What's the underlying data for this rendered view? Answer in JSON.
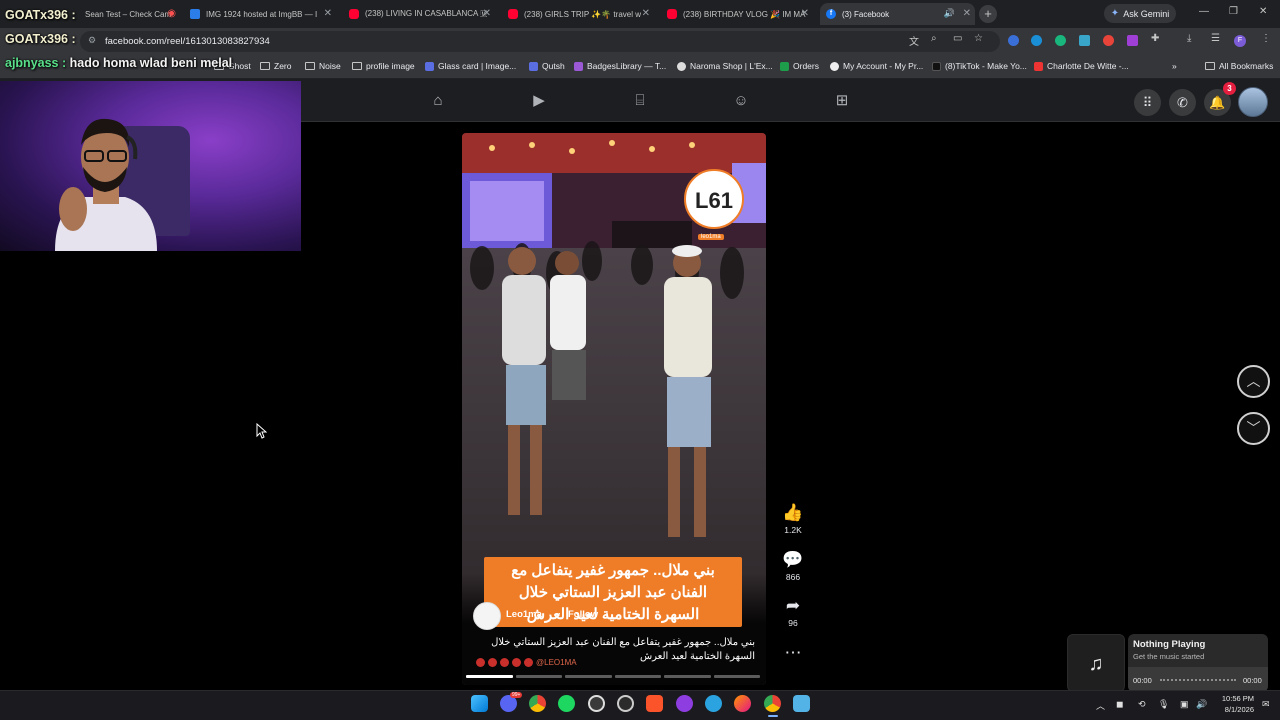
{
  "browser": {
    "tabs": [
      {
        "title": "Sean Test – Check Cam",
        "favicon": "red-circle",
        "active": false
      },
      {
        "title": "IMG 1924 hosted at ImgBB — I",
        "favicon": "imgbb",
        "active": false
      },
      {
        "title": "(238) LIVING IN CASABLANCA 🇲",
        "favicon": "youtube",
        "active": false
      },
      {
        "title": "(238) GIRLS TRIP ✨🌴 travel w",
        "favicon": "youtube",
        "active": false
      },
      {
        "title": "(238) BIRTHDAY VLOG 🎉 IM MA",
        "favicon": "youtube",
        "active": false
      },
      {
        "title": "(3) Facebook",
        "favicon": "facebook",
        "active": true
      }
    ],
    "new_tab": "+",
    "ask_gemini": "Ask Gemini",
    "url": "facebook.com/reel/1613013083827934",
    "bookmarks": [
      {
        "label": "Ghost"
      },
      {
        "label": "Zero"
      },
      {
        "label": "Noise"
      },
      {
        "label": "profile image"
      },
      {
        "label": "Glass card | Image..."
      },
      {
        "label": "Qutsh"
      },
      {
        "label": "BadgesLibrary — T..."
      },
      {
        "label": "Naroma Shop | L'Ex..."
      },
      {
        "label": "Orders"
      },
      {
        "label": "My Account - My Pr..."
      },
      {
        "label": "(8)TikTok - Make Yo..."
      },
      {
        "label": "Charlotte De Witte -..."
      }
    ],
    "all_bookmarks": "All Bookmarks",
    "more_bookmarks": "»",
    "profile_letter": "F"
  },
  "stream_overlay": {
    "name_1": "GOATx396 :",
    "name_2": "GOATx396 :",
    "chat_user": "ajbnyass :",
    "chat_message": "hado homa wlad beni melal"
  },
  "facebook": {
    "notification_count": "3",
    "reel": {
      "logo_text": "L61",
      "logo_sub": "leo1ma",
      "caption_overlay_lines": [
        "بني ملال.. جمهور غفير يتفاعل مع",
        "الفنان عبد العزيز الستاتي خلال",
        "السهرة الختامية لعيد العرش"
      ],
      "channel_name": "Leo1ma",
      "follow": "Follow",
      "description_line1": "بني ملال.. جمهور غفير يتفاعل مع الفنان عبد العزيز الستاتي خلال",
      "description_line2": "السهرة الختامية لعيد العرش",
      "watermark": "@LEO1MA",
      "progress_segments": 6,
      "progress_done": 1
    },
    "actions": {
      "likes": "1.2K",
      "comments": "866",
      "shares": "96"
    }
  },
  "media_widget": {
    "title": "Nothing Playing",
    "subtitle": "Get the music started",
    "time_start": "00:00",
    "time_end": "00:00"
  },
  "taskbar": {
    "time": "10:56 PM",
    "date": "8/1/2026",
    "discord_badge": "99+"
  },
  "colors": {
    "facebook_blue": "#1877f2",
    "caption_orange": "#ef7d27",
    "notification_red": "#e41e3f"
  }
}
